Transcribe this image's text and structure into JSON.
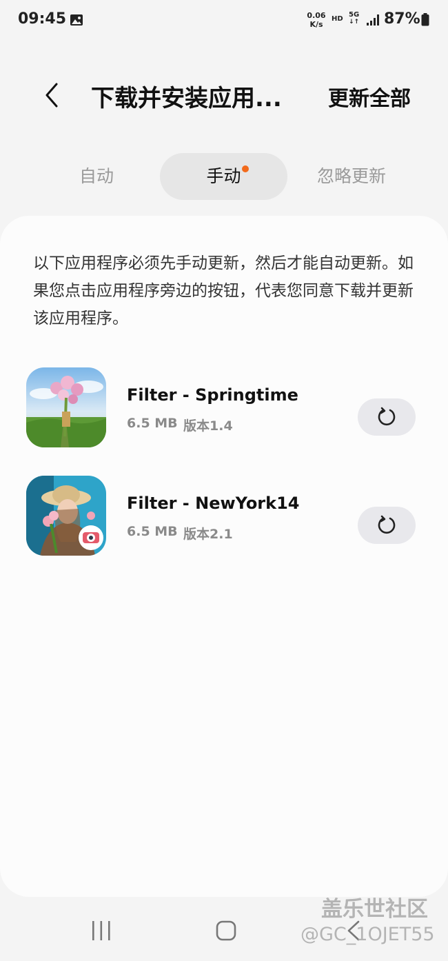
{
  "status_bar": {
    "time": "09:45",
    "net_speed_value": "0.06",
    "net_speed_unit": "K/s",
    "hd": "HD",
    "network_type": "5G",
    "battery": "87%"
  },
  "header": {
    "title": "下载并安装应用...",
    "update_all": "更新全部"
  },
  "tabs": [
    {
      "label": "自动"
    },
    {
      "label": "手动",
      "has_notification_dot": true
    },
    {
      "label": "忽略更新"
    }
  ],
  "selected_tab": "手动",
  "description": "以下应用程序必须先手动更新，然后才能自动更新。如果您点击应用程序旁边的按钮，代表您同意下载并更新该应用程序。",
  "apps": [
    {
      "name": "Filter - Springtime",
      "size": "6.5 MB",
      "version": "版本1.4",
      "icon": "springtime-photo-icon"
    },
    {
      "name": "Filter - NewYork14",
      "size": "6.5 MB",
      "version": "版本2.1",
      "icon": "newyork-portrait-icon"
    }
  ],
  "watermark": {
    "line1": "盖乐世社区",
    "line2": "@GC_1OJET55"
  },
  "colors": {
    "background": "#f4f4f4",
    "card": "#fcfcfc",
    "selected_tab_bg": "#e6e6e6",
    "notification_dot": "#f26a1b",
    "button_bg": "#e8e8ec"
  }
}
